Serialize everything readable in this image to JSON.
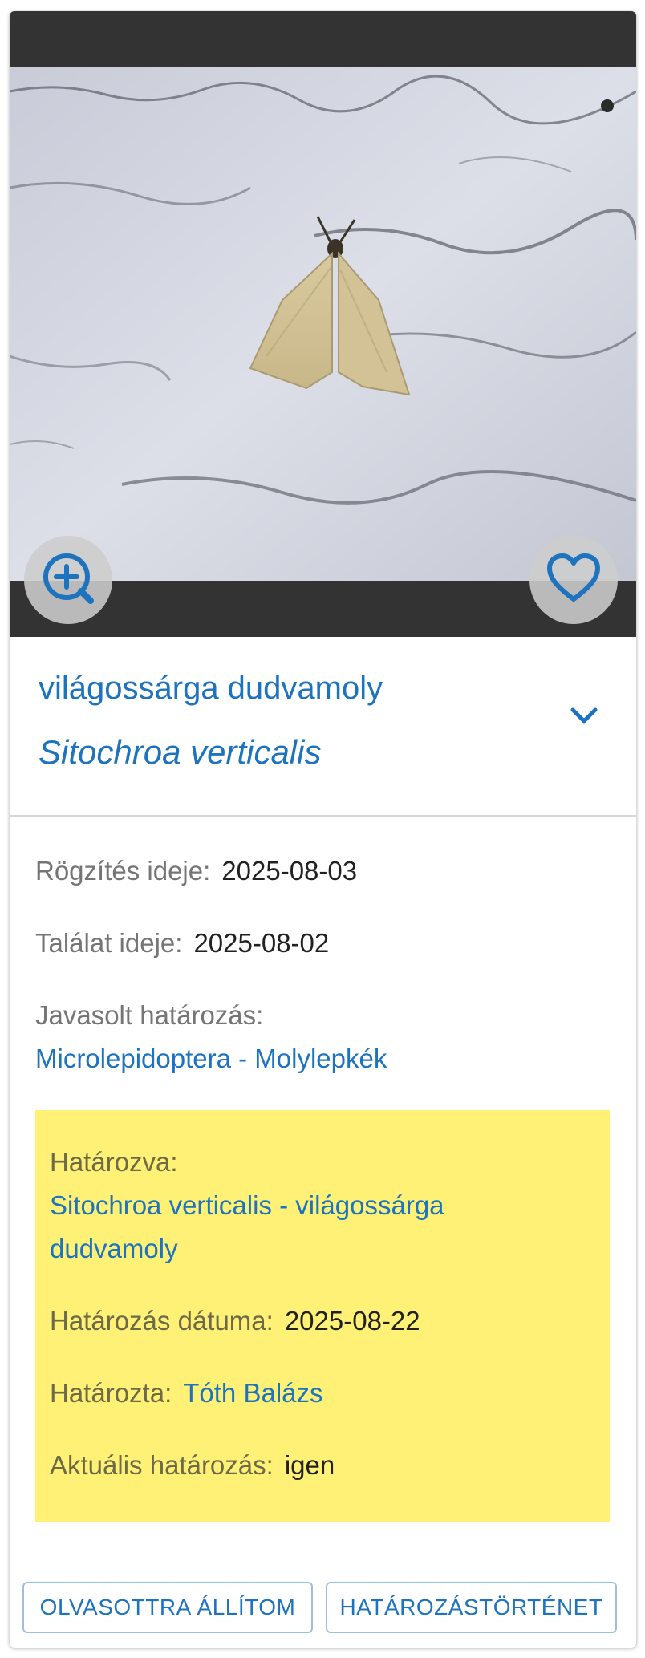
{
  "observation": {
    "common_name": "világossárga dudvamoly",
    "scientific_name": "Sitochroa verticalis"
  },
  "details": {
    "recorded_label": "Rögzítés ideje:",
    "recorded_value": "2025-08-03",
    "found_label": "Találat ideje:",
    "found_value": "2025-08-02",
    "suggested_label": "Javasolt határozás:",
    "suggested_value": "Microlepidoptera - Molylepkék"
  },
  "identification": {
    "identified_label": "Határozva:",
    "identified_line1": "Sitochroa verticalis - világossárga",
    "identified_line2": "dudvamoly",
    "date_label": "Határozás dátuma:",
    "date_value": "2025-08-22",
    "by_label": "Határozta:",
    "by_value": "Tóth Balázs",
    "current_label": "Aktuális határozás:",
    "current_value": "igen"
  },
  "actions": {
    "mark_read": "OLVASOTTRA ÁLLÍTOM",
    "history": "HATÁROZÁSTÖRTÉNET"
  },
  "icons": {
    "zoom": "zoom-in-icon",
    "favorite": "heart-outline-icon",
    "expand": "chevron-down-icon"
  },
  "colors": {
    "accent": "#1e73be",
    "highlight": "#fff176",
    "frame": "#333333"
  }
}
